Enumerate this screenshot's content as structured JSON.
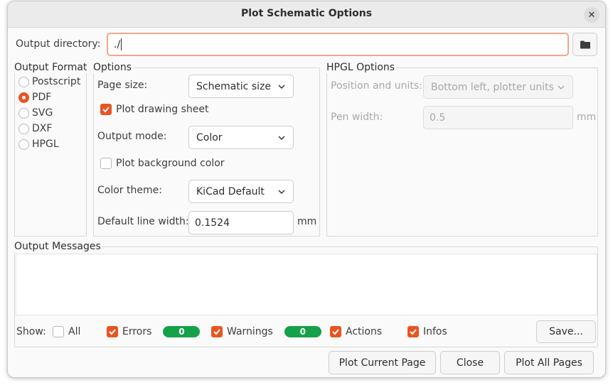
{
  "window": {
    "title": "Plot Schematic Options"
  },
  "output_dir": {
    "label": "Output directory:",
    "value": "./"
  },
  "output_format": {
    "title": "Output Format",
    "options": [
      "Postscript",
      "PDF",
      "SVG",
      "DXF",
      "HPGL"
    ],
    "selected": "PDF"
  },
  "options": {
    "title": "Options",
    "page_size_label": "Page size:",
    "page_size_value": "Schematic size",
    "plot_drawing_sheet_label": "Plot drawing sheet",
    "plot_drawing_sheet_checked": true,
    "output_mode_label": "Output mode:",
    "output_mode_value": "Color",
    "plot_background_label": "Plot background color",
    "plot_background_checked": false,
    "color_theme_label": "Color theme:",
    "color_theme_value": "KiCad Default",
    "line_width_label": "Default line width:",
    "line_width_value": "0.1524",
    "line_width_unit": "mm"
  },
  "hpgl": {
    "title": "HPGL Options",
    "position_label": "Position and units:",
    "position_value": "Bottom left, plotter units",
    "pen_width_label": "Pen width:",
    "pen_width_value": "0.5",
    "pen_width_unit": "mm"
  },
  "messages": {
    "title": "Output Messages",
    "show_label": "Show:",
    "all_label": "All",
    "errors_label": "Errors",
    "errors_count": "0",
    "warnings_label": "Warnings",
    "warnings_count": "0",
    "actions_label": "Actions",
    "infos_label": "Infos",
    "save_label": "Save..."
  },
  "buttons": {
    "plot_current": "Plot Current Page",
    "close": "Close",
    "plot_all": "Plot All Pages"
  },
  "colors": {
    "accent": "#e95420",
    "badge": "#15a14a"
  }
}
